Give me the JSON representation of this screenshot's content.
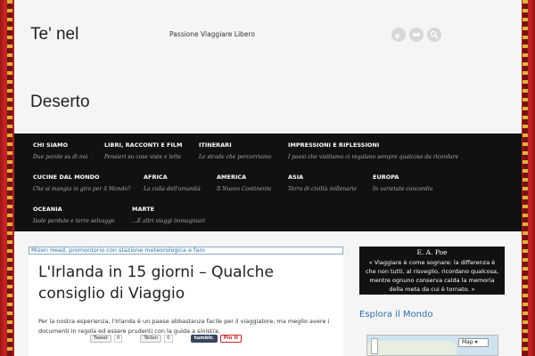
{
  "header": {
    "title_line1": "Te' nel",
    "title_line2": "Deserto",
    "tagline": "Passione Viaggiare Libero",
    "social_icons": [
      "google-plus-icon",
      "flickr-icon",
      "search-icon"
    ]
  },
  "nav": {
    "items": [
      {
        "title": "CHI SIAMO",
        "sub": "Due parole su di noi"
      },
      {
        "title": "LIBRI, RACCONTI E FILM",
        "sub": "Pensieri su cose viste e lette"
      },
      {
        "title": "ITINERARI",
        "sub": "Le strade che percorriamo"
      },
      {
        "title": "IMPRESSIONI E RIFLESSIONI",
        "sub": "I paesi che visitiamo ci regalano sempre qualcosa da ricordare"
      },
      {
        "title": "CUCINE DAL MONDO",
        "sub": "Che si mangia in giro per il Mondo?"
      },
      {
        "title": "AFRICA",
        "sub": "La culla dell'umanità"
      },
      {
        "title": "AMERICA",
        "sub": "Il Nuovo Continente"
      },
      {
        "title": "ASIA",
        "sub": "Terra di civiltà millenarie"
      },
      {
        "title": "EUROPA",
        "sub": "In varietate concordia"
      },
      {
        "title": "OCEANIA",
        "sub": "Isole perdute e terre selvagge"
      },
      {
        "title": "MARTE",
        "sub": "...E altri viaggi immaginari"
      }
    ]
  },
  "caption": "Mizen Head, promontorio con stazione meteorologica e faro",
  "post": {
    "title": "L'Irlanda in 15 giorni – Qualche consiglio di Viaggio",
    "excerpt": "Per la nostra esperienza, l'Irlanda è un paese abbastanza facile per il viaggiatore, ma meglio avere i documenti in regola ed essere prudenti con la guida a sinistra.",
    "share": {
      "tweet_label": "Tweet",
      "tweet_count": "0",
      "gplus_label": "Teilen",
      "gplus_count": "0",
      "tumblr_label": "tumblr.",
      "pin_label": "Pin it"
    }
  },
  "sidebar": {
    "quote_title": "E. A. Poe",
    "quote_text": "« Viaggiare è come sognare: la differenza è che non tutti, al risveglio, ricordano qualcosa, mentre ognuno conserva calda la memoria della meta da cui è tornato. »",
    "explore_heading": "Esplora il Mondo",
    "map_type_label": "Map"
  },
  "colors": {
    "accent_blue": "#2a6fb0",
    "nav_bg": "#111111",
    "background_red": "#b51d1d"
  }
}
